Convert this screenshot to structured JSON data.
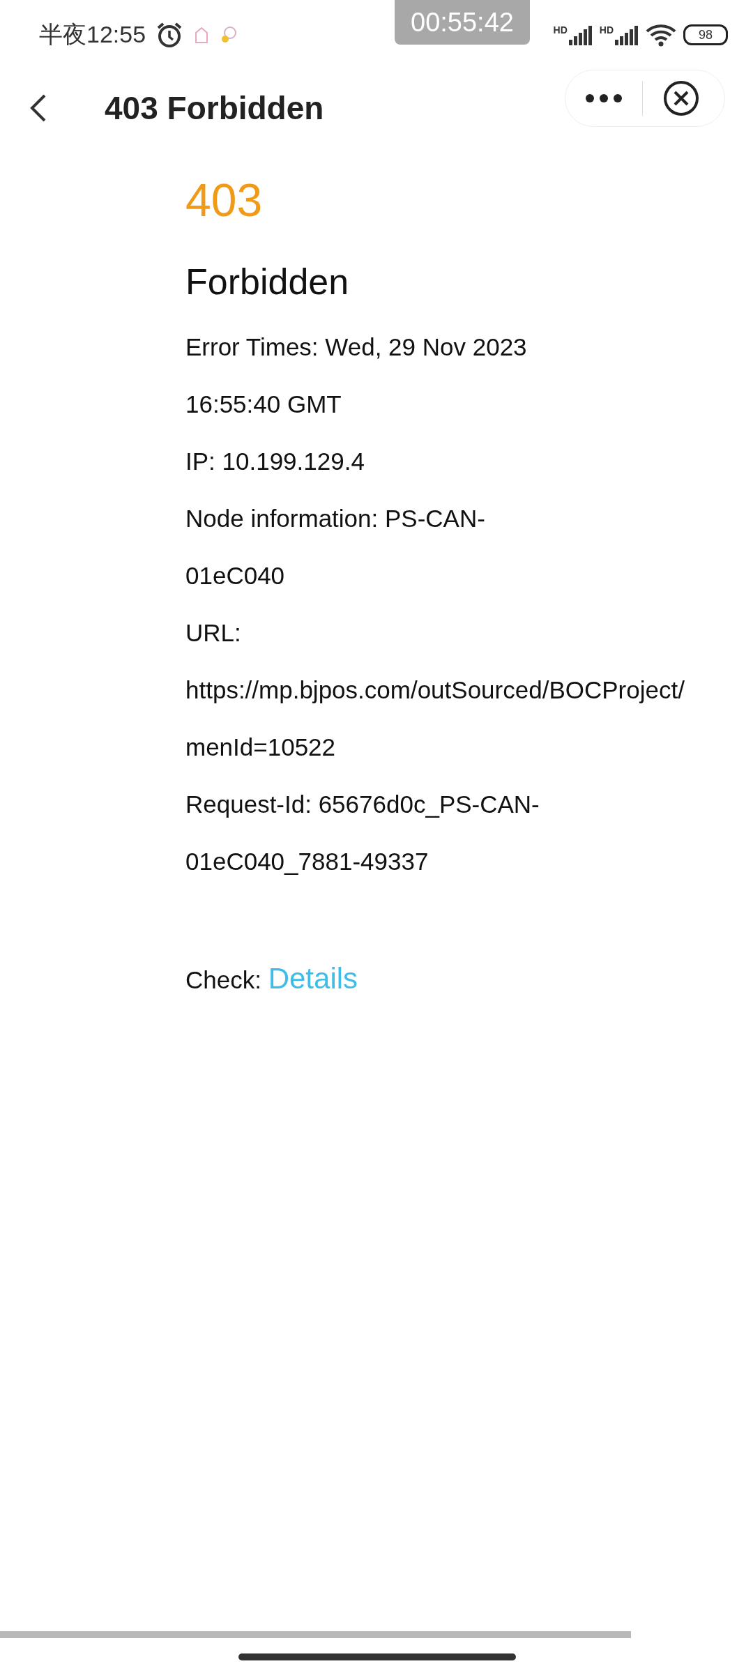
{
  "status_bar": {
    "time": "半夜12:55",
    "recording_timer": "00:55:42",
    "signals": [
      {
        "label": "HD"
      },
      {
        "label": "HD"
      }
    ],
    "battery": "98"
  },
  "nav_bar": {
    "title": "403 Forbidden"
  },
  "page": {
    "code": "403",
    "heading": "Forbidden",
    "lines": [
      "Error Times: Wed, 29 Nov 2023",
      "16:55:40 GMT",
      "IP: 10.199.129.4",
      "Node information: PS-CAN-",
      "01eC040",
      "URL:",
      "https://mp.bjpos.com/outSourced/BOCProject/",
      "menId=10522",
      "Request-Id: 65676d0c_PS-CAN-",
      "01eC040_7881-49337"
    ],
    "check": {
      "label": "Check:",
      "link": "Details"
    }
  }
}
